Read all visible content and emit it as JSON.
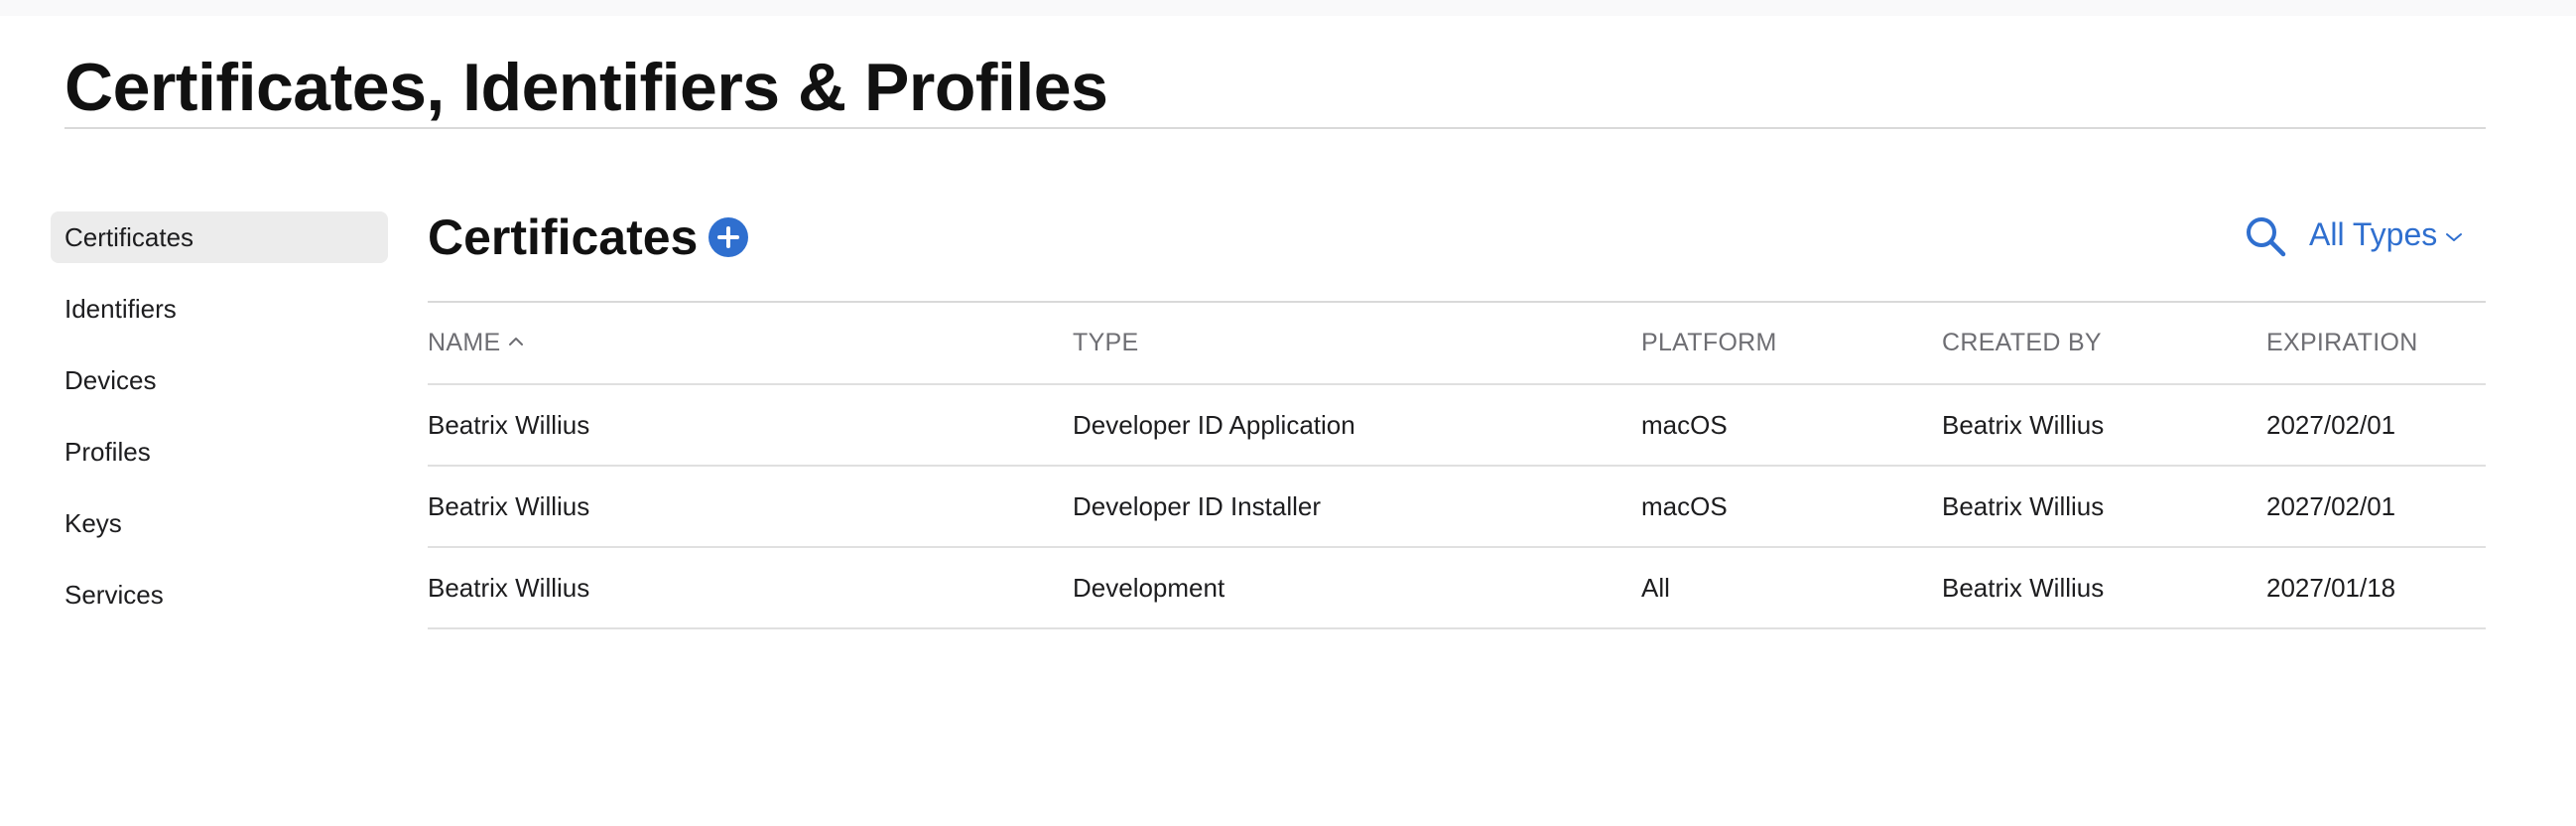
{
  "page": {
    "title": "Certificates, Identifiers & Profiles"
  },
  "sidebar": {
    "items": [
      {
        "label": "Certificates",
        "active": true
      },
      {
        "label": "Identifiers"
      },
      {
        "label": "Devices"
      },
      {
        "label": "Profiles"
      },
      {
        "label": "Keys"
      },
      {
        "label": "Services"
      }
    ]
  },
  "content": {
    "title": "Certificates",
    "add_icon": "plus-circle-icon",
    "search_icon": "search-icon",
    "filter": {
      "selected": "All Types",
      "icon": "chevron-down-icon"
    }
  },
  "table": {
    "sort": {
      "column": "NAME",
      "direction": "ascending",
      "icon": "chevron-up-icon"
    },
    "columns": [
      "NAME",
      "TYPE",
      "PLATFORM",
      "CREATED BY",
      "EXPIRATION"
    ],
    "rows": [
      [
        "Beatrix Willius",
        "Developer ID Application",
        "macOS",
        "Beatrix Willius",
        "2027/02/01"
      ],
      [
        "Beatrix Willius",
        "Developer ID Installer",
        "macOS",
        "Beatrix Willius",
        "2027/02/01"
      ],
      [
        "Beatrix Willius",
        "Development",
        "All",
        "Beatrix Willius",
        "2027/01/18"
      ]
    ]
  },
  "colors": {
    "accent": "#2f6fcf",
    "active_bg": "#ececec",
    "divider": "#d9d9d9",
    "header_text": "#6e6e73"
  }
}
